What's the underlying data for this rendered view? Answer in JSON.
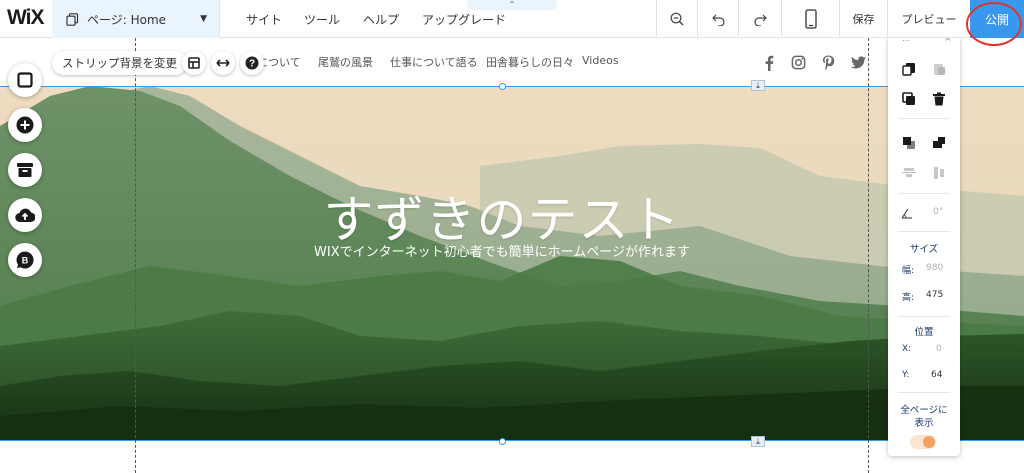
{
  "topbar": {
    "logo": "WiX",
    "page_selector": "ページ: Home",
    "menu": [
      "サイト",
      "ツール",
      "ヘルプ",
      "アップグレード"
    ],
    "collapse_arrow": "⌃",
    "save": "保存",
    "preview": "プレビュー",
    "publish": "公開"
  },
  "site": {
    "nav": [
      "について",
      "尾鷲の風景",
      "仕事について語る",
      "田舎暮らしの日々",
      "Videos"
    ],
    "hero_title": "すずきのテスト",
    "hero_subtitle": "WIXでインターネット初心者でも簡単にホームページが作れます",
    "strip_button": "ストリップ背景を変更",
    "social_icons": [
      "facebook-icon",
      "instagram-icon",
      "pinterest-icon",
      "twitter-icon"
    ]
  },
  "left_toolbar": [
    "page-bg-icon",
    "add-icon",
    "store-icon",
    "upload-icon",
    "blog-icon"
  ],
  "panel": {
    "angle_value": "0°",
    "size_title": "サイズ",
    "width_label": "幅:",
    "width_value": "980",
    "height_label": "高:",
    "height_value": "475",
    "position_title": "位置",
    "x_label": "X:",
    "x_value": "0",
    "y_label": "Y:",
    "y_value": "64",
    "show_all_line1": "全ページに",
    "show_all_line2": "表示",
    "show_all_pages": true
  },
  "colors": {
    "accent": "#3899ec",
    "annotation": "#e0332e",
    "toggle_on": "#f4a261"
  }
}
